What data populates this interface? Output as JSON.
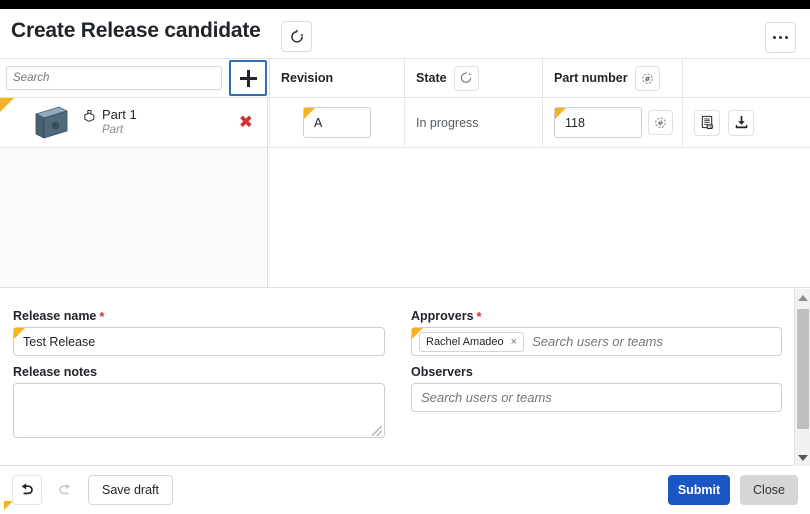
{
  "window": {
    "title": "Create Release candidate",
    "refresh_icon": "refresh-revert-icon",
    "more_icon": "more-options-icon"
  },
  "toolbar": {
    "search_placeholder": "Search",
    "search_value": "",
    "add_icon": "plus-icon"
  },
  "table": {
    "columns": [
      {
        "label": "Revision",
        "icon": null
      },
      {
        "label": "State",
        "icon": "state-rollback-icon"
      },
      {
        "label": "Part number",
        "icon": "part-number-icon"
      },
      {
        "label": "",
        "icon": null
      }
    ],
    "rows": [
      {
        "name": "Part 1",
        "type": "Part",
        "thumbnail_icon": "part-thumbnail",
        "item_icon": "part-glyph-icon",
        "delete_icon": "delete-x-icon",
        "revision": "A",
        "state": "In progress",
        "part_number": "118",
        "part_number_icon": "part-number-icon",
        "action_icons": [
          "report-icon",
          "download-icon"
        ],
        "modified_flag": true
      }
    ]
  },
  "form": {
    "release_name": {
      "label": "Release name",
      "required": true,
      "value": "Test Release",
      "modified_flag": true
    },
    "release_notes": {
      "label": "Release notes",
      "required": false,
      "value": ""
    },
    "approvers": {
      "label": "Approvers",
      "required": true,
      "placeholder": "Search users or teams",
      "modified_flag": true,
      "chips": [
        {
          "name": "Rachel Amadeo",
          "remove_icon": "chip-remove-icon"
        }
      ]
    },
    "observers": {
      "label": "Observers",
      "required": false,
      "placeholder": "Search users or teams",
      "chips": []
    },
    "required_marker": "*"
  },
  "footer": {
    "undo_icon": "undo-arrow-icon",
    "redo_icon": "redo-arrow-icon",
    "save_draft_label": "Save draft",
    "submit_label": "Submit",
    "close_label": "Close"
  },
  "colors": {
    "accent_blue": "#1a56c4",
    "focus_blue": "#2f6fb5",
    "modified_yellow": "#f5b324",
    "danger_red": "#d32f2f",
    "panel_gray": "#fafafa",
    "close_gray": "#d6d6d6"
  }
}
